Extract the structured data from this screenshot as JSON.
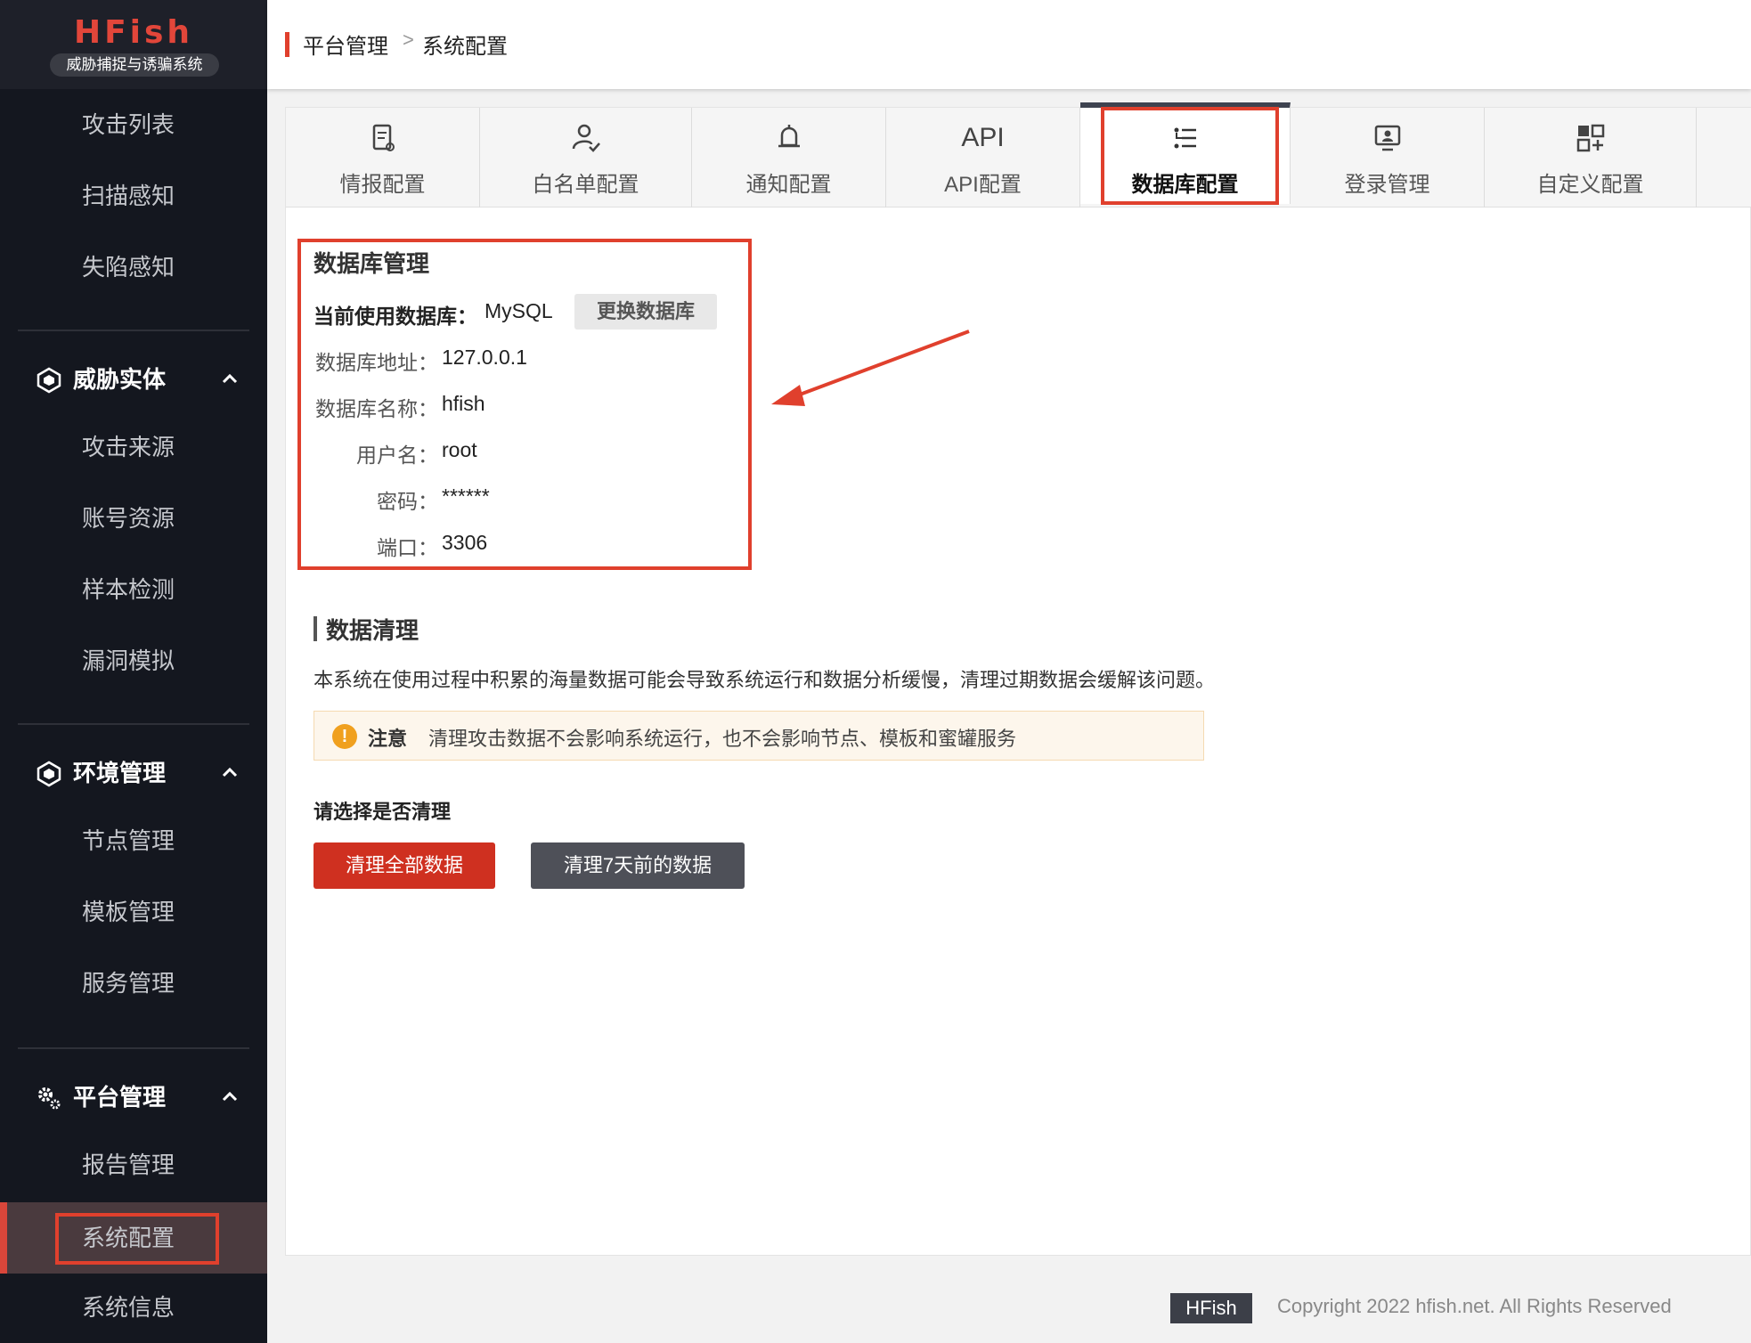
{
  "sidebar": {
    "logo_title": "HFish",
    "logo_subtitle": "威胁捕捉与诱骗系统",
    "top_items": [
      "攻击列表",
      "扫描感知",
      "失陷感知"
    ],
    "groups": [
      {
        "label": "威胁实体",
        "items": [
          "攻击来源",
          "账号资源",
          "样本检测",
          "漏洞模拟"
        ]
      },
      {
        "label": "环境管理",
        "items": [
          "节点管理",
          "模板管理",
          "服务管理"
        ]
      },
      {
        "label": "平台管理",
        "items": [
          "报告管理",
          "系统配置",
          "系统信息"
        ]
      }
    ]
  },
  "header": {
    "crumb1": "平台管理",
    "separator": ">",
    "crumb2": "系统配置"
  },
  "tabs": [
    {
      "label": "情报配置",
      "icon": "intel-icon"
    },
    {
      "label": "白名单配置",
      "icon": "user-check-icon"
    },
    {
      "label": "通知配置",
      "icon": "bell-icon"
    },
    {
      "label": "API配置",
      "icon": "API"
    },
    {
      "label": "数据库配置",
      "icon": "database-config-icon",
      "active": true
    },
    {
      "label": "登录管理",
      "icon": "login-monitor-icon"
    },
    {
      "label": "自定义配置",
      "icon": "grid-add-icon"
    }
  ],
  "db": {
    "title": "数据库管理",
    "current_label": "当前使用数据库：",
    "current_value": "MySQL",
    "switch_button": "更换数据库",
    "fields": [
      {
        "label": "数据库地址：",
        "value": "127.0.0.1"
      },
      {
        "label": "数据库名称：",
        "value": "hfish"
      },
      {
        "label": "用户名：",
        "value": "root"
      },
      {
        "label": "密码：",
        "value": "******"
      },
      {
        "label": "端口：",
        "value": "3306"
      }
    ]
  },
  "clean": {
    "title": "数据清理",
    "description": "本系统在使用过程中积累的海量数据可能会导致系统运行和数据分析缓慢，清理过期数据会缓解该问题。",
    "notice_title": "注意",
    "notice_text": "清理攻击数据不会影响系统运行，也不会影响节点、模板和蜜罐服务",
    "choose_label": "请选择是否清理",
    "btn_all": "清理全部数据",
    "btn_7days": "清理7天前的数据"
  },
  "footer": {
    "badge": "HFish",
    "copyright": "Copyright 2022 hfish.net. All Rights Reserved"
  },
  "colors": {
    "accent_red": "#e0402d",
    "sidebar_bg": "#14171f",
    "button_red": "#cf3020",
    "button_gray": "#4e5058"
  }
}
